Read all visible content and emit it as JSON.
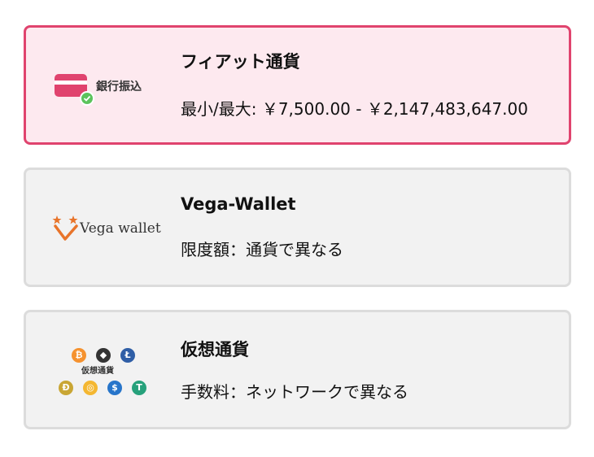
{
  "payment_methods": [
    {
      "title": "フィアット通貨",
      "detail": "最小/最大: ￥7,500.00 - ￥2,147,483,647.00",
      "logo_text": "銀行振込",
      "selected": true
    },
    {
      "title": "Vega-Wallet",
      "detail": "限度額：通貨で異なる",
      "logo_text": "Vega wallet",
      "selected": false
    },
    {
      "title": "仮想通貨",
      "detail": "手数料：ネットワークで異なる",
      "logo_text": "仮想通貨",
      "selected": false
    }
  ],
  "crypto_coins": [
    {
      "icon": "bitcoin-icon",
      "glyph": "₿",
      "color": "#f5922f"
    },
    {
      "icon": "ethereum-icon",
      "glyph": "◆",
      "color": "#333333"
    },
    {
      "icon": "litecoin-icon",
      "glyph": "Ł",
      "color": "#2f5ea6"
    },
    {
      "icon": "dogecoin-icon",
      "glyph": "Ð",
      "color": "#c9a634"
    },
    {
      "icon": "dai-icon",
      "glyph": "◎",
      "color": "#f4b731"
    },
    {
      "icon": "usdc-icon",
      "glyph": "$",
      "color": "#2775ca"
    },
    {
      "icon": "tether-icon",
      "glyph": "T",
      "color": "#26a17b"
    }
  ],
  "colors": {
    "accent": "#e0436e",
    "selected_bg": "#fde9ef",
    "card_bg": "#f2f2f2",
    "card_border": "#dcdcdc",
    "check": "#5cc35c"
  }
}
